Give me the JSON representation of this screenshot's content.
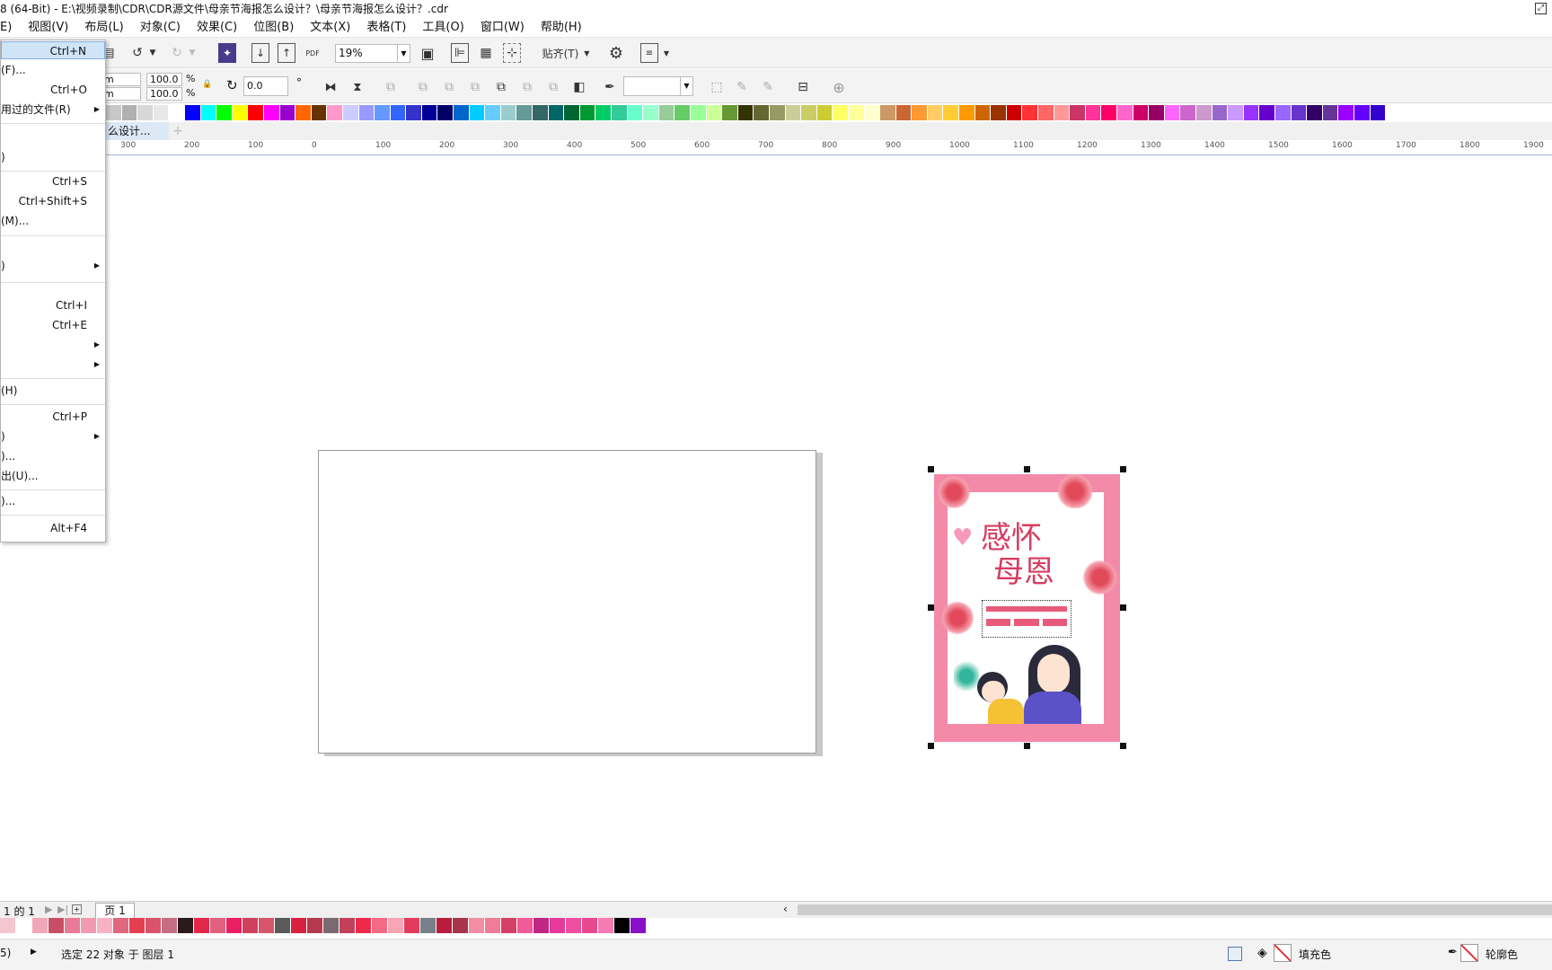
{
  "window": {
    "title": "8 (64-Bit) - E:\\视频录制\\CDR\\CDR源文件\\母亲节海报怎么设计？\\母亲节海报怎么设计？.cdr"
  },
  "menubar": {
    "items": [
      {
        "label": "E)"
      },
      {
        "label": "视图(V)"
      },
      {
        "label": "布局(L)"
      },
      {
        "label": "对象(C)"
      },
      {
        "label": "效果(C)"
      },
      {
        "label": "位图(B)"
      },
      {
        "label": "文本(X)"
      },
      {
        "label": "表格(T)"
      },
      {
        "label": "工具(O)"
      },
      {
        "label": "窗口(W)"
      },
      {
        "label": "帮助(H)"
      }
    ]
  },
  "file_menu": {
    "items": [
      {
        "label": "",
        "shortcut": "Ctrl+N",
        "highlighted": true
      },
      {
        "label": "(F)...",
        "shortcut": ""
      },
      {
        "label": "",
        "shortcut": "Ctrl+O"
      },
      {
        "label": "用过的文件(R)",
        "shortcut": "",
        "submenu": true
      },
      {
        "label": ")",
        "shortcut": ""
      },
      {
        "label": "",
        "shortcut": "Ctrl+S"
      },
      {
        "label": "",
        "shortcut": "Ctrl+Shift+S"
      },
      {
        "label": "(M)...",
        "shortcut": ""
      },
      {
        "label": ")",
        "shortcut": "",
        "submenu": true
      },
      {
        "label": "",
        "shortcut": "Ctrl+I"
      },
      {
        "label": "",
        "shortcut": "Ctrl+E"
      },
      {
        "label": "",
        "shortcut": "",
        "submenu": true
      },
      {
        "label": "",
        "shortcut": "",
        "submenu": true
      },
      {
        "label": "(H)",
        "shortcut": ""
      },
      {
        "label": "",
        "shortcut": "Ctrl+P"
      },
      {
        "label": ")",
        "shortcut": "",
        "submenu": true
      },
      {
        "label": ")...",
        "shortcut": ""
      },
      {
        "label": "出(U)...",
        "shortcut": ""
      },
      {
        "label": ")...",
        "shortcut": ""
      },
      {
        "label": "",
        "shortcut": "Alt+F4"
      }
    ]
  },
  "toolbar": {
    "zoom_value": "19%",
    "snap_label": "贴齐(T)",
    "pdf_label": "PDF"
  },
  "property_bar": {
    "unit_1": "m",
    "unit_2": "m",
    "scale_x": "100.0",
    "scale_y": "100.0",
    "percent_1": "%",
    "percent_2": "%",
    "rotation": "0.0",
    "degree_symbol": "°"
  },
  "document_tab": {
    "label": "么设计..."
  },
  "ruler": {
    "labels": [
      "300",
      "200",
      "100",
      "0",
      "100",
      "200",
      "300",
      "400",
      "500",
      "600",
      "700",
      "800",
      "900",
      "1000",
      "1100",
      "1200",
      "1300",
      "1400",
      "1500",
      "1600",
      "1700",
      "1800",
      "1900"
    ]
  },
  "poster": {
    "title_line1": "感怀",
    "title_line2": "母恩"
  },
  "page_nav": {
    "page_count_text": "1 的 1",
    "page_tab": "页 1"
  },
  "statusbar": {
    "left_text": "5)",
    "selection_text": "选定 22 对象 于 图层 1",
    "fill_label": "填充色",
    "outline_label": "轮廓色"
  },
  "colors": {
    "palette_top": [
      "#c8c8c8",
      "#b0b0b0",
      "#d8d8d8",
      "#e8e8e8",
      "#ffffff",
      "#0000ff",
      "#00ffff",
      "#00ff00",
      "#ffff00",
      "#ff0000",
      "#ff00ff",
      "#9900cc",
      "#ff6600",
      "#663300",
      "#ff99cc",
      "#ccccff",
      "#9999ff",
      "#6699ff",
      "#3366ff",
      "#3333cc",
      "#000099",
      "#000066",
      "#0066cc",
      "#00ccff",
      "#66ccff",
      "#99cccc",
      "#669999",
      "#336666",
      "#006666",
      "#006633",
      "#009933",
      "#00cc66",
      "#33cc99",
      "#66ffcc",
      "#99ffcc",
      "#99cc99",
      "#66cc66",
      "#99ff99",
      "#ccff99",
      "#669933",
      "#333300",
      "#666633",
      "#999966",
      "#cccc99",
      "#cccc66",
      "#cccc33",
      "#ffff66",
      "#ffff99",
      "#ffffcc",
      "#cc9966",
      "#cc6633",
      "#ff9933",
      "#ffcc66",
      "#ffcc33",
      "#ff9900",
      "#cc6600",
      "#993300",
      "#cc0000",
      "#ff3333",
      "#ff6666",
      "#ff9999",
      "#cc3366",
      "#ff3399",
      "#ff0066",
      "#ff66cc",
      "#cc0066",
      "#990066",
      "#ff66ff",
      "#cc66cc",
      "#cc99cc",
      "#9966cc",
      "#cc99ff",
      "#9933ff",
      "#6600cc",
      "#9966ff",
      "#6633cc",
      "#330066",
      "#663399",
      "#9900ff",
      "#6600ff",
      "#3300cc"
    ],
    "palette_bottom": [
      "#f4c6d0",
      "#ffffff",
      "#f2a7b8",
      "#c84e66",
      "#e87b97",
      "#f29ab0",
      "#f7b3c4",
      "#e0677e",
      "#e2404f",
      "#d9536a",
      "#c56d82",
      "#2a1a1e",
      "#e3274a",
      "#e0607e",
      "#ea1e63",
      "#cf405c",
      "#d6556a",
      "#5a5a5a",
      "#d8213f",
      "#b53a4e",
      "#7a6a6f",
      "#c2405a",
      "#ee2a4a",
      "#f26a84",
      "#f9a5b6",
      "#e43a5c",
      "#778088",
      "#b81d3c",
      "#a6344a",
      "#f58da4",
      "#ef7d97",
      "#d54066",
      "#f25a9a",
      "#c12685",
      "#e6399b",
      "#ef4fa0",
      "#e54a8e",
      "#f57ab0",
      "#000000",
      "#8a10c8"
    ],
    "selection": "#000000",
    "poster_border": "#f28aa8"
  }
}
